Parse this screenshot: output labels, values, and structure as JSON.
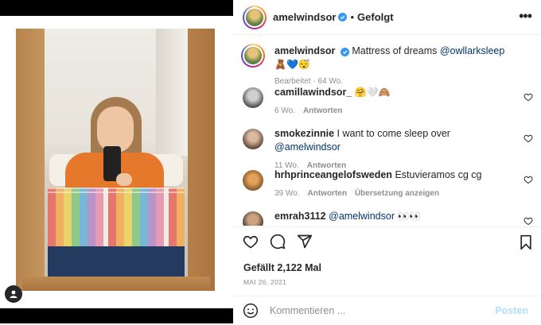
{
  "header": {
    "username": "amelwindsor",
    "separator": "•",
    "follow_status": "Gefolgt",
    "more": "•••"
  },
  "caption": {
    "username": "amelwindsor",
    "text": "Mattress of dreams",
    "mention": "@owllarksleep",
    "emojis": "🧸💙😴",
    "meta": "Bearbeitet · 64 Wo."
  },
  "comments": [
    {
      "username": "camillawindsor_",
      "text": "",
      "emojis": "🤗🤍🙈",
      "age": "6 Wo.",
      "reply": "Antworten",
      "translate": ""
    },
    {
      "username": "smokezinnie",
      "text": "I want to come sleep over",
      "mention": "@amelwindsor",
      "age": "11 Wo.",
      "reply": "Antworten",
      "translate": ""
    },
    {
      "username": "hrhprinceangelofsweden",
      "text": "Estuvieramos cg cg",
      "age": "39 Wo.",
      "reply": "Antworten",
      "translate": "Übersetzung anzeigen"
    },
    {
      "username": "emrah3112",
      "text": "",
      "mention": "@amelwindsor",
      "emojis": "👀👀"
    }
  ],
  "post": {
    "likes": "Gefällt 2,122 Mal",
    "date": "MAI 26, 2021",
    "comment_placeholder": "Kommentieren ...",
    "post_label": "Posten"
  },
  "colors": {
    "verified": "#3897f0",
    "mention": "#00376b",
    "post_disabled": "#b2dffc",
    "muted": "#8e8e8e"
  },
  "icons": [
    "heart-icon",
    "comment-icon",
    "share-icon",
    "bookmark-icon",
    "smiley-icon",
    "verified-icon",
    "user-tag-icon",
    "more-icon"
  ]
}
